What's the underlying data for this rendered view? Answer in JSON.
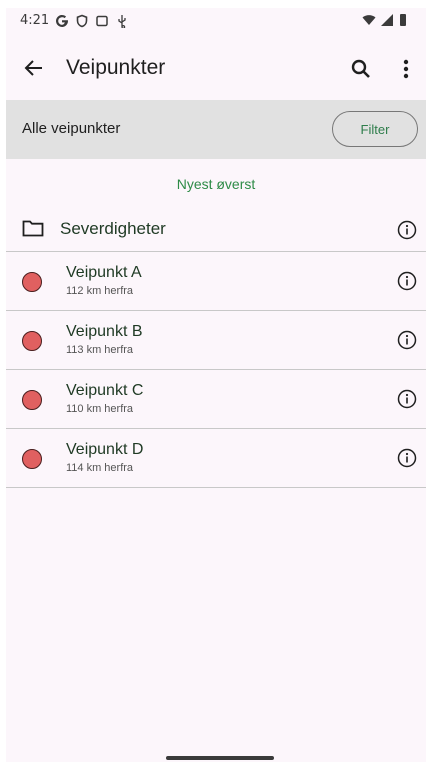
{
  "status_bar": {
    "time": "4:21",
    "icons": [
      "google-g-icon",
      "shield-icon",
      "screenshot-icon",
      "usb-icon"
    ],
    "right_icons": [
      "wifi-icon",
      "signal-icon",
      "battery-icon"
    ]
  },
  "app_bar": {
    "title": "Veipunkter",
    "back_icon": "arrow-back-icon",
    "search_icon": "search-icon",
    "more_icon": "more-vert-icon"
  },
  "filter_bar": {
    "label": "Alle veipunkter",
    "button_label": "Filter"
  },
  "sort_label": "Nyest øverst",
  "folder": {
    "name": "Severdigheter",
    "icon": "folder-icon"
  },
  "waypoints": [
    {
      "name": "Veipunkt A",
      "distance": "112 km herfra"
    },
    {
      "name": "Veipunkt B",
      "distance": "113 km herfra"
    },
    {
      "name": "Veipunkt C",
      "distance": "110 km herfra"
    },
    {
      "name": "Veipunkt D",
      "distance": "114 km herfra"
    }
  ],
  "colors": {
    "accent": "#2e8b47",
    "waypoint_dot": "#e06060",
    "background": "#fcf6fb",
    "filter_bar": "#e1e1e1"
  }
}
